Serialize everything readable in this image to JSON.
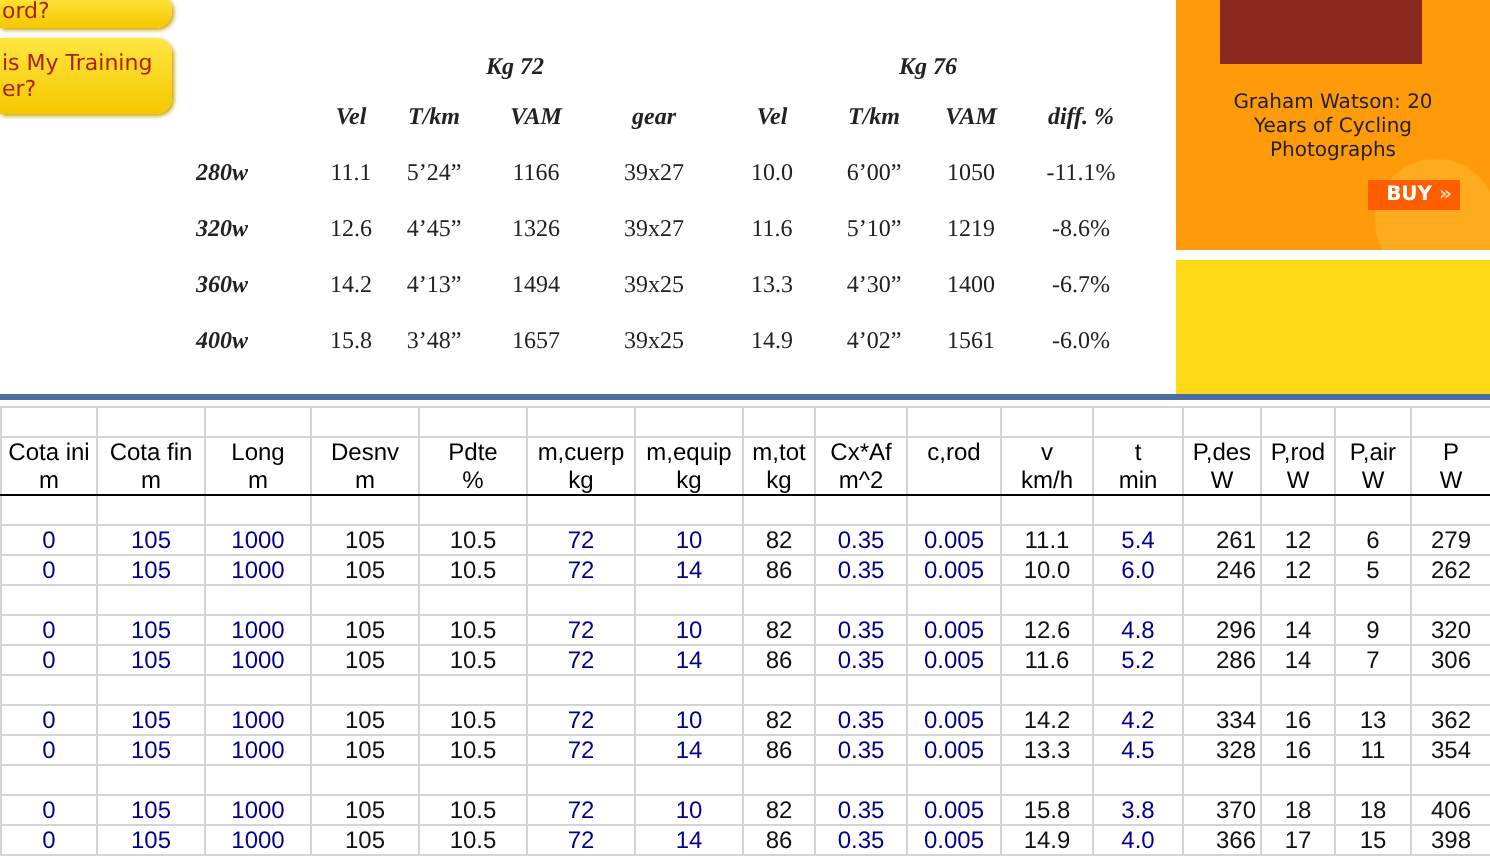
{
  "nav": [
    {
      "lines": [
        "ord?"
      ]
    },
    {
      "lines": [
        "is My Training",
        "er?"
      ]
    }
  ],
  "comparison": {
    "groups": [
      {
        "label": "Kg  72"
      },
      {
        "label": "Kg  76"
      }
    ],
    "columns": [
      "Vel",
      "T/km",
      "VAM",
      "gear",
      "Vel",
      "T/km",
      "VAM",
      "diff. %"
    ],
    "rows": [
      {
        "label": "280w",
        "cells": [
          "11.1",
          "5’24”",
          "1166",
          "39x27",
          "10.0",
          "6’00”",
          "1050",
          "-11.1%"
        ]
      },
      {
        "label": "320w",
        "cells": [
          "12.6",
          "4’45”",
          "1326",
          "39x27",
          "11.6",
          "5’10”",
          "1219",
          "-8.6%"
        ]
      },
      {
        "label": "360w",
        "cells": [
          "14.2",
          "4’13”",
          "1494",
          "39x25",
          "13.3",
          "4’30”",
          "1400",
          "-6.7%"
        ]
      },
      {
        "label": "400w",
        "cells": [
          "15.8",
          "3’48”",
          "1657",
          "39x25",
          "14.9",
          "4’02”",
          "1561",
          "-6.0%"
        ]
      }
    ]
  },
  "ad": {
    "text": "Graham Watson: 20 Years of Cycling Photographs",
    "button": "BUY",
    "button_icon": "»"
  },
  "sheet": {
    "columns": [
      {
        "name": "Cota ini",
        "unit": "m",
        "kind": "input"
      },
      {
        "name": "Cota fin",
        "unit": "m",
        "kind": "input"
      },
      {
        "name": "Long",
        "unit": "m",
        "kind": "input"
      },
      {
        "name": "Desnv",
        "unit": "m",
        "kind": "calc"
      },
      {
        "name": "Pdte",
        "unit": "%",
        "kind": "calc"
      },
      {
        "name": "m,cuerp",
        "unit": "kg",
        "kind": "input"
      },
      {
        "name": "m,equip",
        "unit": "kg",
        "kind": "input"
      },
      {
        "name": "m,tot",
        "unit": "kg",
        "kind": "calc"
      },
      {
        "name": "Cx*Af",
        "unit": "m^2",
        "kind": "input"
      },
      {
        "name": "c,rod",
        "kind": "input"
      },
      {
        "name": "v",
        "unit": "km/h",
        "kind": "calc"
      },
      {
        "name": "t",
        "unit": "min",
        "kind": "input"
      },
      {
        "name": "P,des",
        "unit": "W",
        "kind": "calc"
      },
      {
        "name": "P,rod",
        "unit": "W",
        "kind": "calc"
      },
      {
        "name": "P,air",
        "unit": "W",
        "kind": "calc"
      },
      {
        "name": "P",
        "unit": "W",
        "kind": "calc"
      }
    ],
    "groups": [
      [
        [
          "0",
          "105",
          "1000",
          "105",
          "10.5",
          "72",
          "10",
          "82",
          "0.35",
          "0.005",
          "11.1",
          "5.4",
          "261",
          "12",
          "6",
          "279"
        ],
        [
          "0",
          "105",
          "1000",
          "105",
          "10.5",
          "72",
          "14",
          "86",
          "0.35",
          "0.005",
          "10.0",
          "6.0",
          "246",
          "12",
          "5",
          "262"
        ]
      ],
      [
        [
          "0",
          "105",
          "1000",
          "105",
          "10.5",
          "72",
          "10",
          "82",
          "0.35",
          "0.005",
          "12.6",
          "4.8",
          "296",
          "14",
          "9",
          "320"
        ],
        [
          "0",
          "105",
          "1000",
          "105",
          "10.5",
          "72",
          "14",
          "86",
          "0.35",
          "0.005",
          "11.6",
          "5.2",
          "286",
          "14",
          "7",
          "306"
        ]
      ],
      [
        [
          "0",
          "105",
          "1000",
          "105",
          "10.5",
          "72",
          "10",
          "82",
          "0.35",
          "0.005",
          "14.2",
          "4.2",
          "334",
          "16",
          "13",
          "362"
        ],
        [
          "0",
          "105",
          "1000",
          "105",
          "10.5",
          "72",
          "14",
          "86",
          "0.35",
          "0.005",
          "13.3",
          "4.5",
          "328",
          "16",
          "11",
          "354"
        ]
      ],
      [
        [
          "0",
          "105",
          "1000",
          "105",
          "10.5",
          "72",
          "10",
          "82",
          "0.35",
          "0.005",
          "15.8",
          "3.8",
          "370",
          "18",
          "18",
          "406"
        ],
        [
          "0",
          "105",
          "1000",
          "105",
          "10.5",
          "72",
          "14",
          "86",
          "0.35",
          "0.005",
          "14.9",
          "4.0",
          "366",
          "17",
          "15",
          "398"
        ]
      ]
    ]
  }
}
